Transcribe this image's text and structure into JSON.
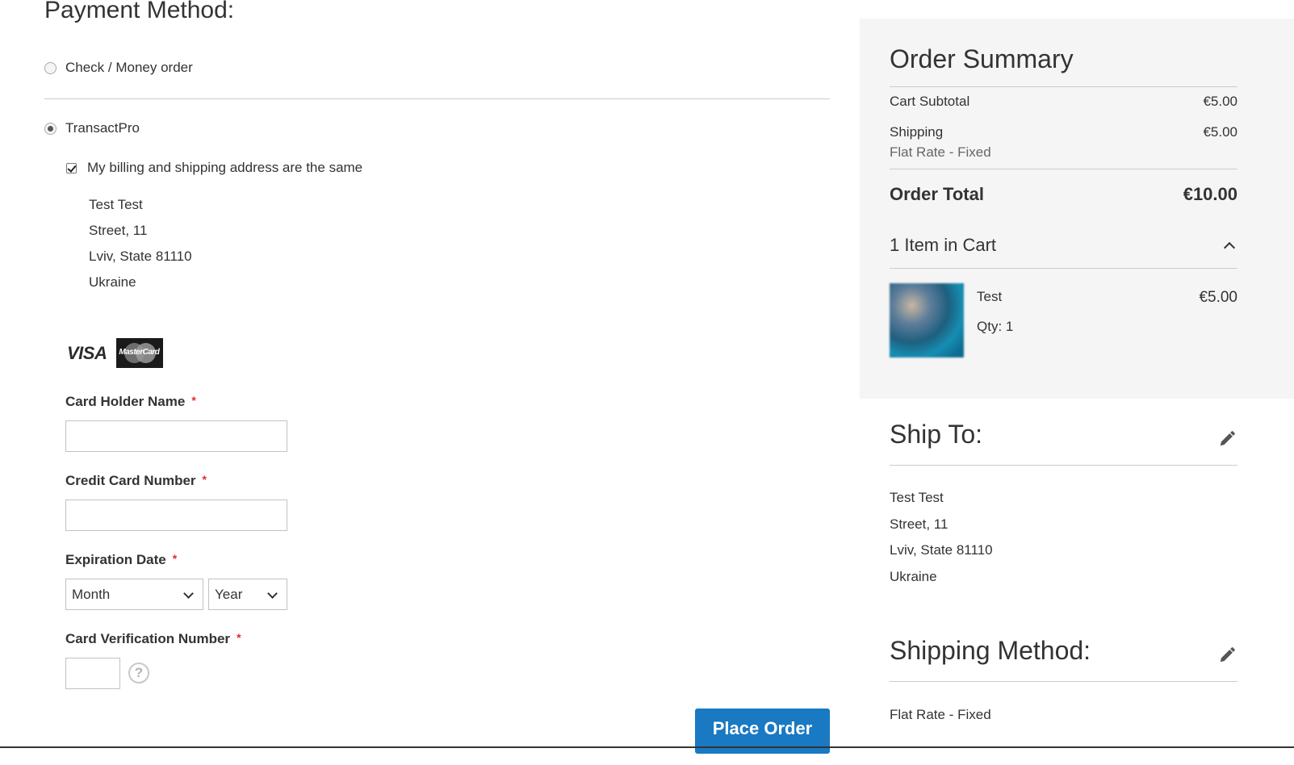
{
  "payment": {
    "title": "Payment Method:",
    "methods": [
      {
        "label": "Check / Money order",
        "selected": false
      },
      {
        "label": "TransactPro",
        "selected": true
      }
    ],
    "same_address_label": "My billing and shipping address are the same",
    "same_address_checked": true,
    "billing_address": [
      "Test Test",
      "Street, 11",
      "Lviv, State 81110",
      "Ukraine"
    ],
    "card_logos": {
      "visa": "VISA",
      "mastercard": "MasterCard"
    },
    "fields": {
      "holder_label": "Card Holder Name",
      "number_label": "Credit Card Number",
      "expiration_label": "Expiration Date",
      "cvv_label": "Card Verification Number",
      "required_marker": "*",
      "month_value": "Month",
      "year_value": "Year",
      "holder_value": "",
      "number_value": "",
      "cvv_value": ""
    },
    "help_icon": "?",
    "place_order_label": "Place Order"
  },
  "summary": {
    "title": "Order Summary",
    "subtotal_label": "Cart Subtotal",
    "subtotal_value": "€5.00",
    "shipping_label": "Shipping",
    "shipping_value": "€5.00",
    "shipping_method": "Flat Rate - Fixed",
    "total_label": "Order Total",
    "total_value": "€10.00",
    "items_label": "1 Item in Cart",
    "item": {
      "name": "Test",
      "price": "€5.00",
      "qty": "Qty: 1"
    }
  },
  "ship_to": {
    "title": "Ship To:",
    "address": [
      "Test Test",
      "Street, 11",
      "Lviv, State 81110",
      "Ukraine"
    ]
  },
  "shipping_method": {
    "title": "Shipping Method:",
    "value": "Flat Rate - Fixed"
  },
  "colors": {
    "primary_button": "#1979c3",
    "required": "#e02b27",
    "summary_bg": "#f5f5f5"
  },
  "icons": {
    "edit": "pencil-icon",
    "collapse": "chevron-up-icon",
    "select": "chevron-down-icon",
    "help": "question-circle-icon"
  }
}
